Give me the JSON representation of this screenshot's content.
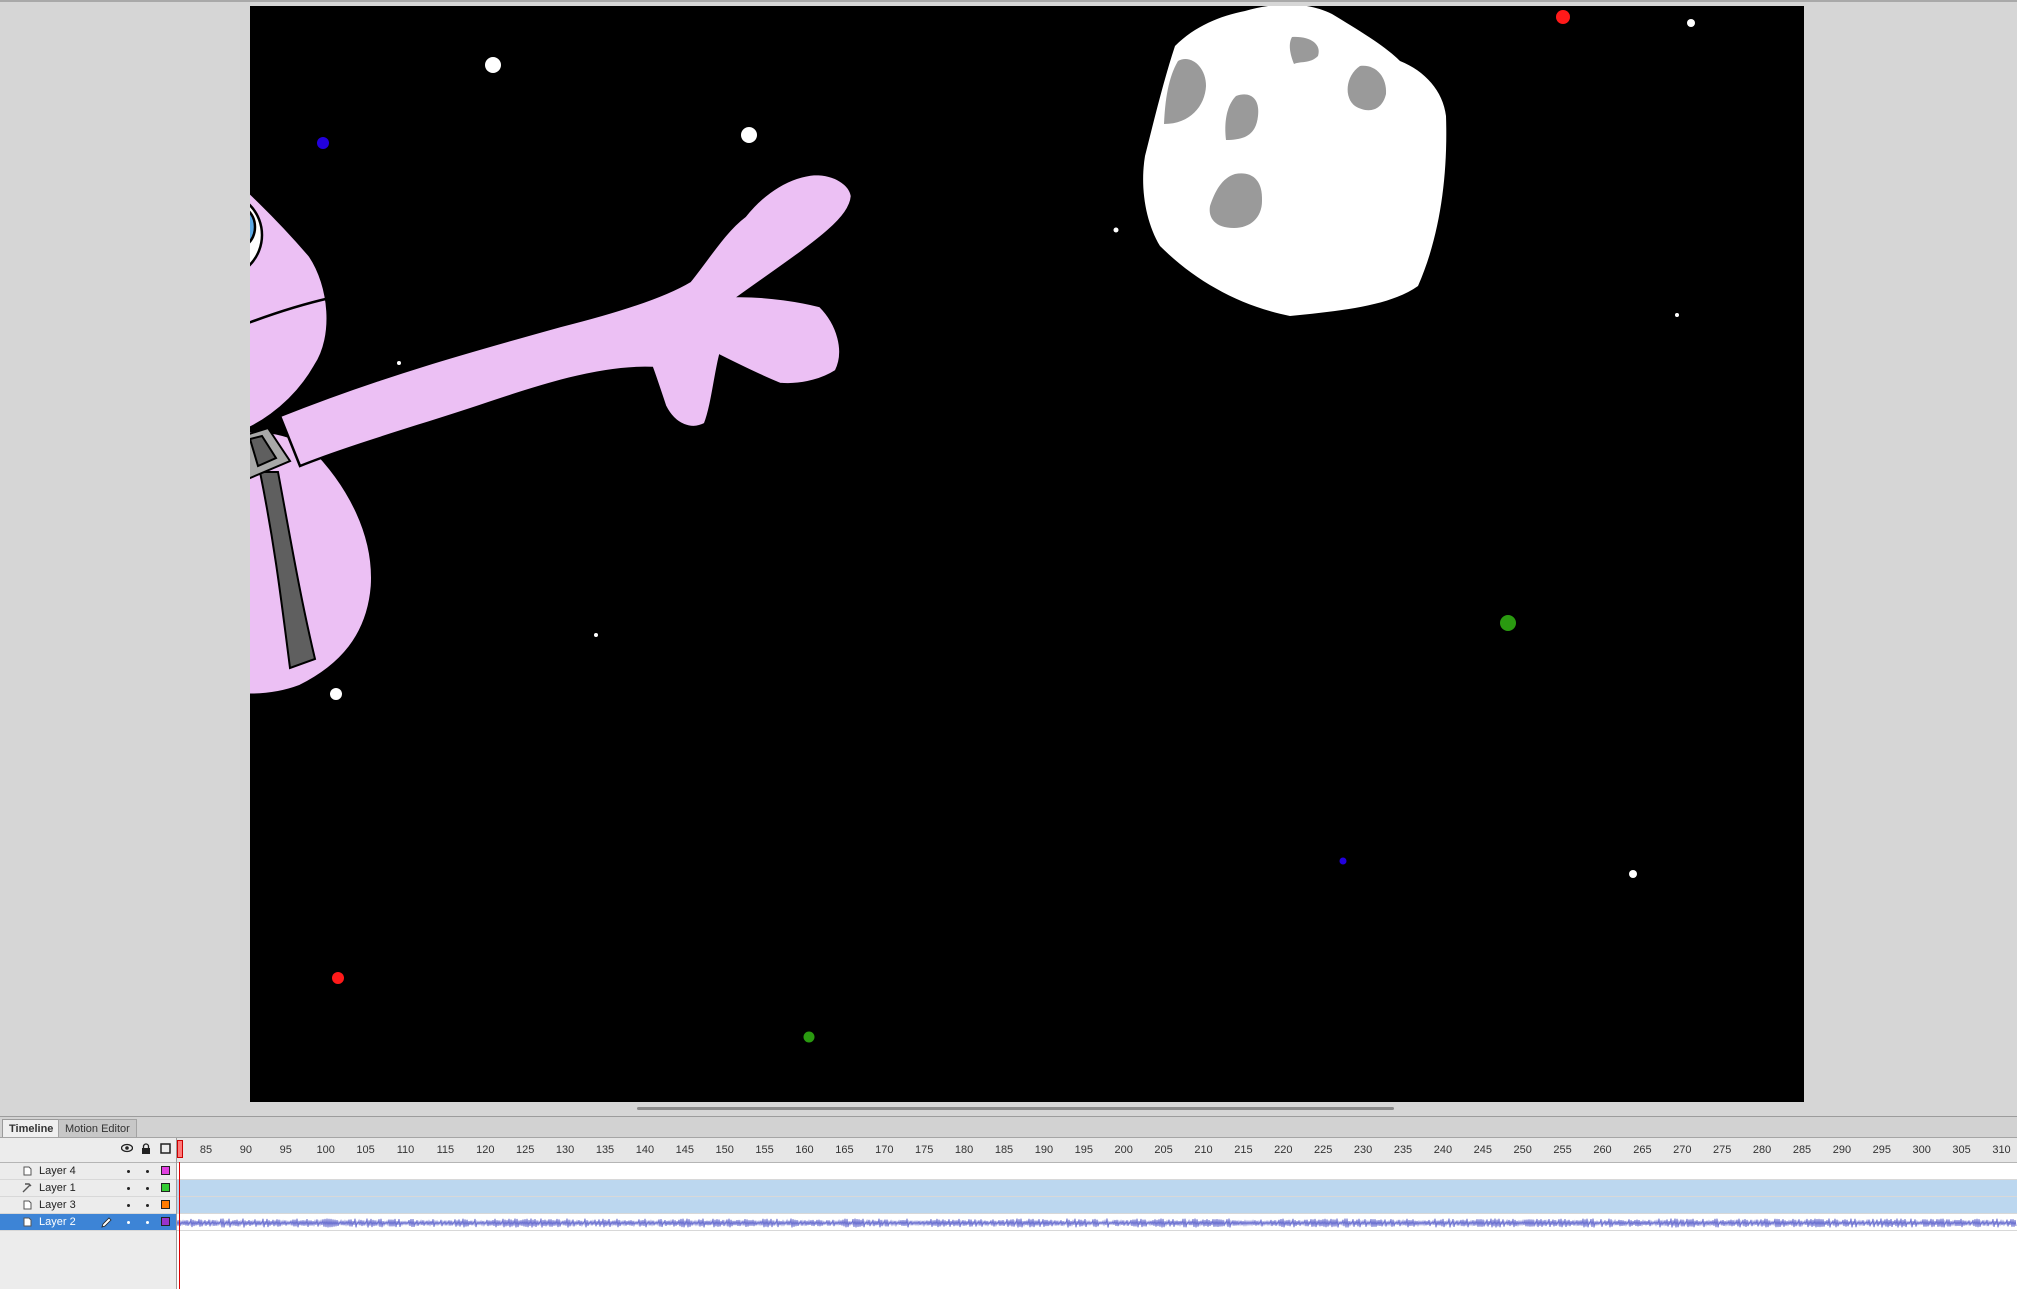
{
  "tabs": [
    {
      "label": "Timeline"
    },
    {
      "label": "Motion Editor"
    }
  ],
  "layers": [
    {
      "name": "Layer 4",
      "color": "#e040e0",
      "selected": false
    },
    {
      "name": "Layer 1",
      "color": "#33cc33",
      "selected": false
    },
    {
      "name": "Layer 3",
      "color": "#ff7a00",
      "selected": false
    },
    {
      "name": "Layer 2",
      "color": "#9933cc",
      "selected": true
    }
  ],
  "ruler_labels": [
    "85",
    "90",
    "95",
    "100",
    "105",
    "110",
    "115",
    "120",
    "125",
    "130",
    "135",
    "140",
    "145",
    "150",
    "155",
    "160",
    "165",
    "170",
    "175",
    "180",
    "185",
    "190",
    "195",
    "200",
    "205",
    "210",
    "215",
    "220",
    "225",
    "230",
    "235",
    "240",
    "245",
    "250",
    "255",
    "260",
    "265",
    "270",
    "275",
    "280",
    "285",
    "290",
    "295",
    "300",
    "305",
    "310"
  ],
  "header_icons": [
    "eye-icon",
    "lock-icon",
    "outline-icon"
  ],
  "stage": {
    "background": "#000000",
    "character_color": "#ecc0f4",
    "asteroid_color": "#ffffff",
    "crater_color": "#9a9a9a"
  }
}
